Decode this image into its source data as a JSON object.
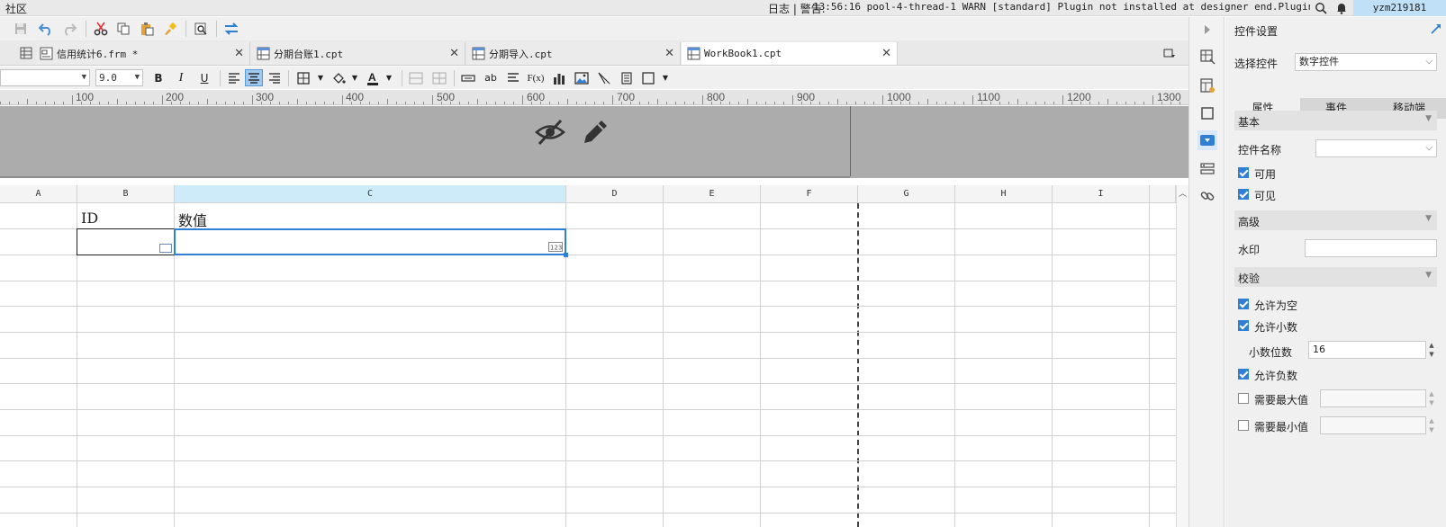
{
  "topbar": {
    "community": "社区",
    "log": "日志 | 警告:",
    "warning": "13:56:16 pool-4-thread-1 WARN [standard] Plugin not installed at designer end.Plugin ...",
    "user": "yzm219181"
  },
  "tabs": [
    {
      "label": "信用统计6.frm *",
      "active": false
    },
    {
      "label": "分期台账1.cpt",
      "active": false
    },
    {
      "label": "分期导入.cpt",
      "active": false
    },
    {
      "label": "WorkBook1.cpt",
      "active": true
    }
  ],
  "format": {
    "font_name": "",
    "font_size": "9.0",
    "bold": "B",
    "italic": "I",
    "underline": "U",
    "text_icon": "ab",
    "formula": "F(x)"
  },
  "ruler": [
    "100",
    "200",
    "300",
    "400",
    "500",
    "600",
    "700",
    "800",
    "900",
    "1000",
    "1100",
    "1200",
    "1300"
  ],
  "sheet": {
    "columns": [
      "A",
      "B",
      "C",
      "D",
      "E",
      "F",
      "G",
      "H",
      "I"
    ],
    "selected_column": "C",
    "cells": {
      "b1": "ID",
      "c1": "数值"
    }
  },
  "panel": {
    "title": "控件设置",
    "select_label": "选择控件",
    "select_value": "数字控件",
    "tabs": [
      "属性",
      "事件",
      "移动端"
    ],
    "active_tab": "属性",
    "basic": {
      "title": "基本",
      "name_label": "控件名称",
      "name_value": "",
      "enabled_label": "可用",
      "enabled": true,
      "visible_label": "可见",
      "visible": true
    },
    "advanced": {
      "title": "高级",
      "watermark_label": "水印",
      "watermark_value": ""
    },
    "validation": {
      "title": "校验",
      "allow_empty_label": "允许为空",
      "allow_empty": true,
      "allow_decimal_label": "允许小数",
      "allow_decimal": true,
      "decimal_places_label": "小数位数",
      "decimal_places": "16",
      "allow_negative_label": "允许负数",
      "allow_negative": true,
      "need_max_label": "需要最大值",
      "need_max": false,
      "max_value": "",
      "need_min_label": "需要最小值",
      "need_min": false,
      "min_value": ""
    }
  },
  "colors": {
    "accent": "#2f7fd4",
    "selected_header": "#cdebf8",
    "user_badge": "#bfe0f7"
  }
}
